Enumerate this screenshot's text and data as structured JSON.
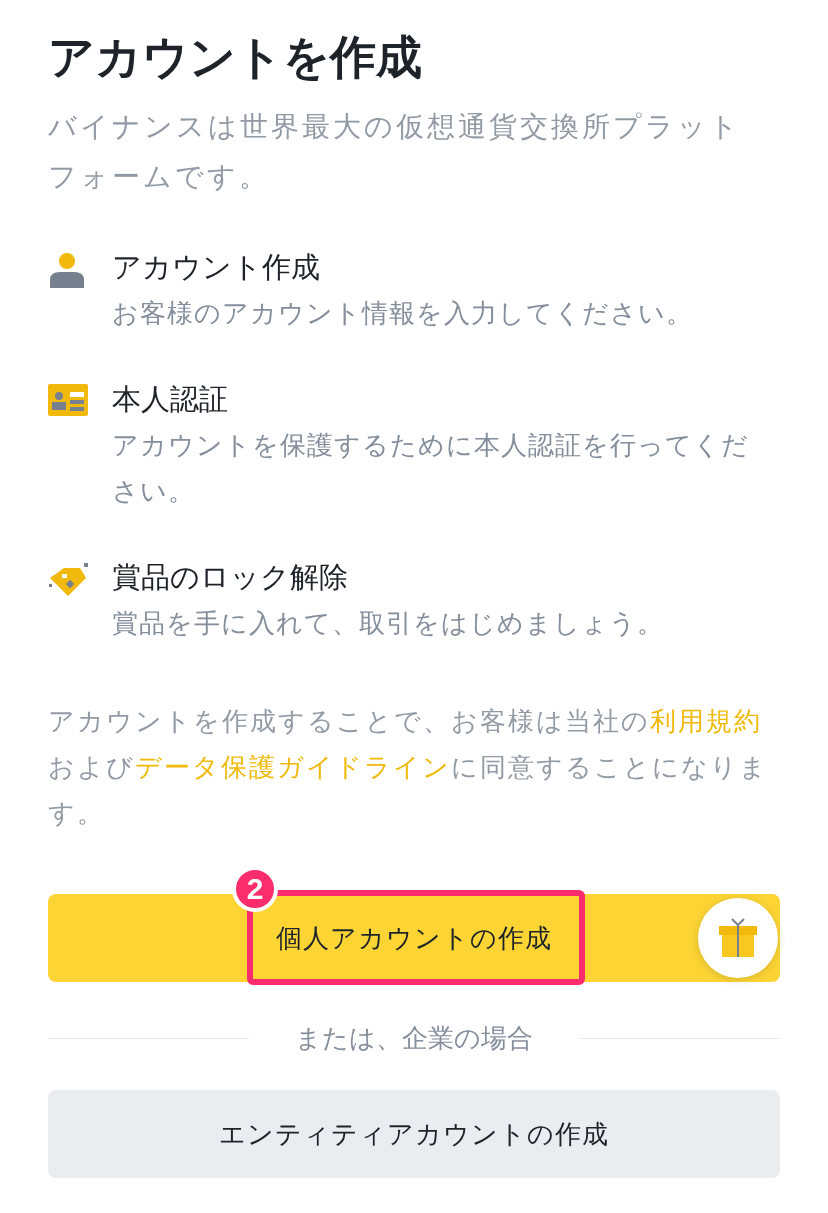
{
  "title": "アカウントを作成",
  "subtitle": "バイナンスは世界最大の仮想通貨交換所プラットフォームです。",
  "steps": [
    {
      "kind": "person",
      "title": "アカウント作成",
      "description": "お客様のアカウント情報を入力してください。"
    },
    {
      "kind": "id-card",
      "title": "本人認証",
      "description": "アカウントを保護するために本人認証を行ってください。"
    },
    {
      "kind": "gem",
      "title": "賞品のロック解除",
      "description": "賞品を手に入れて、取引をはじめましょう。"
    }
  ],
  "legal": [
    {
      "text": "アカウントを作成することで、お客様は当社の",
      "link": false
    },
    {
      "text": "利用規約",
      "link": true
    },
    {
      "text": "および",
      "link": false
    },
    {
      "text": "データ保護ガイドライン",
      "link": true
    },
    {
      "text": "に同意することになります。",
      "link": false
    }
  ],
  "primary_button": {
    "label": "個人アカウントの作成",
    "highlighted": true,
    "annotation": "2"
  },
  "gift_button": {
    "shown": true
  },
  "divider_text": "または、企業の場合",
  "secondary_button": {
    "label": "エンティティアカウントの作成"
  }
}
